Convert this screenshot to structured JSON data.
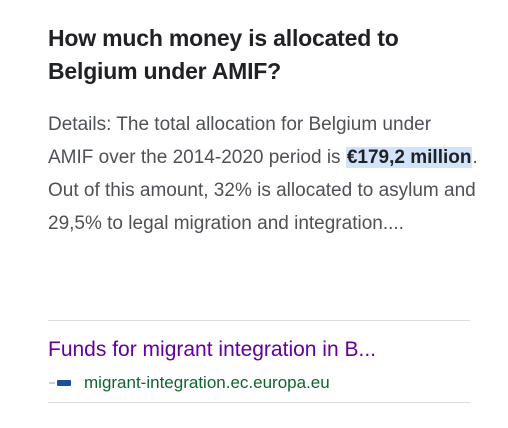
{
  "featured_snippet": {
    "question": "How much money is allocated to Belgium under AMIF?",
    "answer_prefix": "Details: The total allocation for Belgium under AMIF over the 2014-2020 period is ",
    "answer_highlight": "€179,2 million",
    "answer_suffix": ". Out of this amount, 32% is allocated to asylum and 29,5% to legal migration and integration....",
    "result_title": "Funds for migrant integration in B...",
    "result_domain": "migrant-integration.ec.europa.eu",
    "favicon": "eu-flag-icon"
  },
  "colors": {
    "question": "#202124",
    "snippet_text": "#4d5156",
    "highlight_bg": "#d2e3fc",
    "visited_link": "#660099",
    "url_green": "#0d652d",
    "divider": "#dadce0"
  }
}
